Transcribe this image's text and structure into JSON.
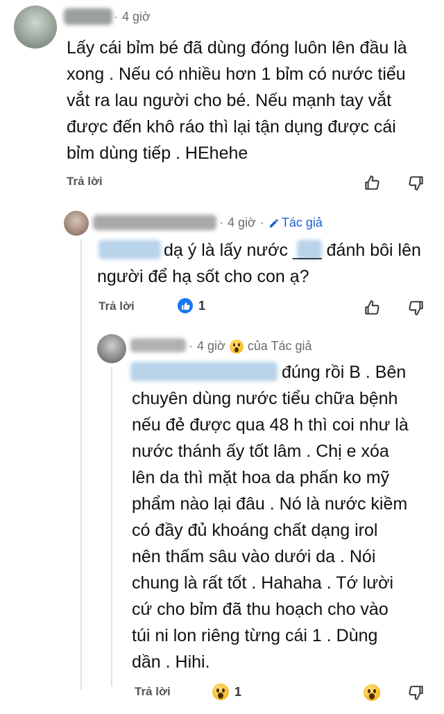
{
  "comments": [
    {
      "time": "4 giờ",
      "author_tag": "",
      "lines": [
        "Lấy cái bỉm bé đã dùng đóng luôn lên đầu là",
        "xong . Nếu có nhiều hơn 1 bỉm có nước tiểu",
        "vắt ra lau người cho bé. Nếu mạnh tay vắt",
        "được đến khô ráo thì lại tận dụng được cái",
        "bỉm dùng tiếp . HEhehe"
      ],
      "reply_label": "Trả lời",
      "reaction_count": ""
    },
    {
      "time": "4 giờ",
      "author_tag": "Tác giả",
      "lines": [
        "dạ ý là lấy nước ___ đánh bôi lên",
        "người để hạ sốt cho con ạ?"
      ],
      "reply_label": "Trả lời",
      "reaction_count": "1"
    },
    {
      "time": "4 giờ",
      "author_tag": "của Tác giả",
      "lines": [
        "đúng rồi B .  Bên",
        "chuyên dùng nước tiểu chữa bệnh",
        "nếu đẻ được qua 48 h thì coi như là",
        "nước thánh ấy tốt lâm . Chị e xóa",
        "lên da thì mặt hoa da phấn ko mỹ",
        "phẩm nào lại đâu . Nó là nước kiềm",
        "có đầy đủ khoáng chất dạng irol",
        "nên thấm sâu vào dưới da . Nói",
        "chung là rất tốt . Hahaha . Tớ lười",
        "cứ cho bỉm đã thu hoạch cho vào",
        "túi ni lon riêng từng cái 1 . Dùng",
        "dần . Hihi."
      ],
      "reply_label": "Trả lời",
      "reaction_count": "1"
    }
  ],
  "colors": {
    "accent": "#1877f2",
    "author_tag": "#1a5fd6",
    "text": "#111111",
    "meta": "#6b6b6b"
  }
}
